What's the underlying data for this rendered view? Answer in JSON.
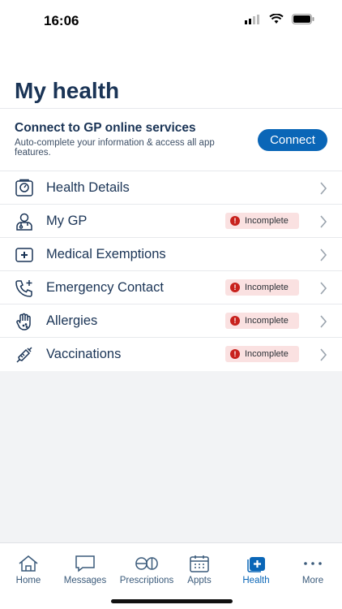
{
  "status": {
    "time": "16:06"
  },
  "page": {
    "title": "My health"
  },
  "connect": {
    "title": "Connect to GP online services",
    "subtitle": "Auto-complete your information & access all app features.",
    "button": "Connect"
  },
  "health_items": [
    {
      "label": "Health Details",
      "icon": "clipboard-icon",
      "badge": ""
    },
    {
      "label": "My GP",
      "icon": "doctor-icon",
      "badge": "Incomplete"
    },
    {
      "label": "Medical Exemptions",
      "icon": "medical-card-icon",
      "badge": ""
    },
    {
      "label": "Emergency Contact",
      "icon": "phone-plus-icon",
      "badge": "Incomplete"
    },
    {
      "label": "Allergies",
      "icon": "hand-icon",
      "badge": "Incomplete"
    },
    {
      "label": "Vaccinations",
      "icon": "syringe-icon",
      "badge": "Incomplete"
    }
  ],
  "tabs": [
    {
      "label": "Home",
      "icon": "home-icon"
    },
    {
      "label": "Messages",
      "icon": "message-icon"
    },
    {
      "label": "Prescriptions",
      "icon": "pills-icon"
    },
    {
      "label": "Appts",
      "icon": "calendar-icon"
    },
    {
      "label": "Health",
      "icon": "health-icon",
      "active": true
    },
    {
      "label": "More",
      "icon": "more-icon"
    }
  ],
  "colors": {
    "accent": "#0a66b7",
    "title": "#1a3456",
    "badge_bg": "#fae1e1",
    "badge_dot": "#c8221d"
  }
}
